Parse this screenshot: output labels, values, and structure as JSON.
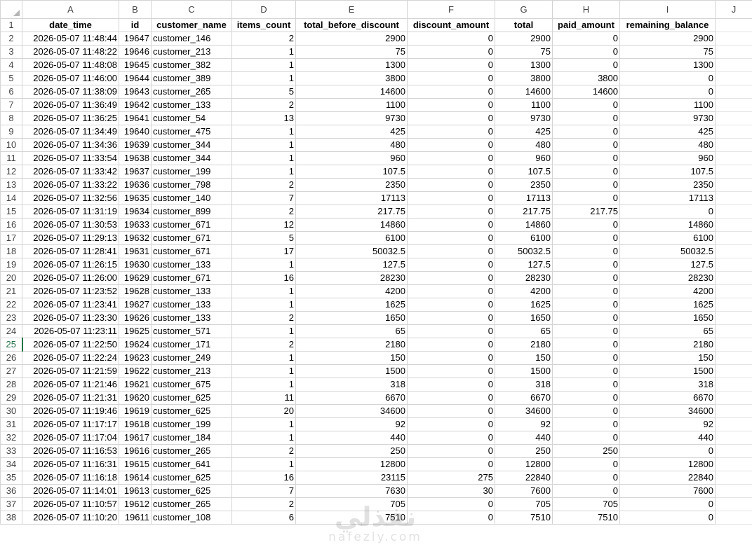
{
  "sheet": {
    "column_letters": [
      "A",
      "B",
      "C",
      "D",
      "E",
      "F",
      "G",
      "H",
      "I",
      "J"
    ],
    "active_row": 25,
    "headers": [
      "date_time",
      "id",
      "customer_name",
      "items_count",
      "total_before_discount",
      "discount_amount",
      "total",
      "paid_amount",
      "remaining_balance"
    ],
    "rows": [
      [
        "2026-05-07 11:48:44",
        "19647",
        "customer_146",
        "2",
        "2900",
        "0",
        "2900",
        "0",
        "2900"
      ],
      [
        "2026-05-07 11:48:22",
        "19646",
        "customer_213",
        "1",
        "75",
        "0",
        "75",
        "0",
        "75"
      ],
      [
        "2026-05-07 11:48:08",
        "19645",
        "customer_382",
        "1",
        "1300",
        "0",
        "1300",
        "0",
        "1300"
      ],
      [
        "2026-05-07 11:46:00",
        "19644",
        "customer_389",
        "1",
        "3800",
        "0",
        "3800",
        "3800",
        "0"
      ],
      [
        "2026-05-07 11:38:09",
        "19643",
        "customer_265",
        "5",
        "14600",
        "0",
        "14600",
        "14600",
        "0"
      ],
      [
        "2026-05-07 11:36:49",
        "19642",
        "customer_133",
        "2",
        "1100",
        "0",
        "1100",
        "0",
        "1100"
      ],
      [
        "2026-05-07 11:36:25",
        "19641",
        "customer_54",
        "13",
        "9730",
        "0",
        "9730",
        "0",
        "9730"
      ],
      [
        "2026-05-07 11:34:49",
        "19640",
        "customer_475",
        "1",
        "425",
        "0",
        "425",
        "0",
        "425"
      ],
      [
        "2026-05-07 11:34:36",
        "19639",
        "customer_344",
        "1",
        "480",
        "0",
        "480",
        "0",
        "480"
      ],
      [
        "2026-05-07 11:33:54",
        "19638",
        "customer_344",
        "1",
        "960",
        "0",
        "960",
        "0",
        "960"
      ],
      [
        "2026-05-07 11:33:42",
        "19637",
        "customer_199",
        "1",
        "107.5",
        "0",
        "107.5",
        "0",
        "107.5"
      ],
      [
        "2026-05-07 11:33:22",
        "19636",
        "customer_798",
        "2",
        "2350",
        "0",
        "2350",
        "0",
        "2350"
      ],
      [
        "2026-05-07 11:32:56",
        "19635",
        "customer_140",
        "7",
        "17113",
        "0",
        "17113",
        "0",
        "17113"
      ],
      [
        "2026-05-07 11:31:19",
        "19634",
        "customer_899",
        "2",
        "217.75",
        "0",
        "217.75",
        "217.75",
        "0"
      ],
      [
        "2026-05-07 11:30:53",
        "19633",
        "customer_671",
        "12",
        "14860",
        "0",
        "14860",
        "0",
        "14860"
      ],
      [
        "2026-05-07 11:29:13",
        "19632",
        "customer_671",
        "5",
        "6100",
        "0",
        "6100",
        "0",
        "6100"
      ],
      [
        "2026-05-07 11:28:41",
        "19631",
        "customer_671",
        "17",
        "50032.5",
        "0",
        "50032.5",
        "0",
        "50032.5"
      ],
      [
        "2026-05-07 11:26:15",
        "19630",
        "customer_133",
        "1",
        "127.5",
        "0",
        "127.5",
        "0",
        "127.5"
      ],
      [
        "2026-05-07 11:26:00",
        "19629",
        "customer_671",
        "16",
        "28230",
        "0",
        "28230",
        "0",
        "28230"
      ],
      [
        "2026-05-07 11:23:52",
        "19628",
        "customer_133",
        "1",
        "4200",
        "0",
        "4200",
        "0",
        "4200"
      ],
      [
        "2026-05-07 11:23:41",
        "19627",
        "customer_133",
        "1",
        "1625",
        "0",
        "1625",
        "0",
        "1625"
      ],
      [
        "2026-05-07 11:23:30",
        "19626",
        "customer_133",
        "2",
        "1650",
        "0",
        "1650",
        "0",
        "1650"
      ],
      [
        "2026-05-07 11:23:11",
        "19625",
        "customer_571",
        "1",
        "65",
        "0",
        "65",
        "0",
        "65"
      ],
      [
        "2026-05-07 11:22:50",
        "19624",
        "customer_171",
        "2",
        "2180",
        "0",
        "2180",
        "0",
        "2180"
      ],
      [
        "2026-05-07 11:22:24",
        "19623",
        "customer_249",
        "1",
        "150",
        "0",
        "150",
        "0",
        "150"
      ],
      [
        "2026-05-07 11:21:59",
        "19622",
        "customer_213",
        "1",
        "1500",
        "0",
        "1500",
        "0",
        "1500"
      ],
      [
        "2026-05-07 11:21:46",
        "19621",
        "customer_675",
        "1",
        "318",
        "0",
        "318",
        "0",
        "318"
      ],
      [
        "2026-05-07 11:21:31",
        "19620",
        "customer_625",
        "11",
        "6670",
        "0",
        "6670",
        "0",
        "6670"
      ],
      [
        "2026-05-07 11:19:46",
        "19619",
        "customer_625",
        "20",
        "34600",
        "0",
        "34600",
        "0",
        "34600"
      ],
      [
        "2026-05-07 11:17:17",
        "19618",
        "customer_199",
        "1",
        "92",
        "0",
        "92",
        "0",
        "92"
      ],
      [
        "2026-05-07 11:17:04",
        "19617",
        "customer_184",
        "1",
        "440",
        "0",
        "440",
        "0",
        "440"
      ],
      [
        "2026-05-07 11:16:53",
        "19616",
        "customer_265",
        "2",
        "250",
        "0",
        "250",
        "250",
        "0"
      ],
      [
        "2026-05-07 11:16:31",
        "19615",
        "customer_641",
        "1",
        "12800",
        "0",
        "12800",
        "0",
        "12800"
      ],
      [
        "2026-05-07 11:16:18",
        "19614",
        "customer_625",
        "16",
        "23115",
        "275",
        "22840",
        "0",
        "22840"
      ],
      [
        "2026-05-07 11:14:01",
        "19613",
        "customer_625",
        "7",
        "7630",
        "30",
        "7600",
        "0",
        "7600"
      ],
      [
        "2026-05-07 11:10:57",
        "19612",
        "customer_265",
        "2",
        "705",
        "0",
        "705",
        "705",
        "0"
      ],
      [
        "2026-05-07 11:10:20",
        "19611",
        "customer_108",
        "6",
        "7510",
        "0",
        "7510",
        "7510",
        "0"
      ]
    ]
  },
  "watermark": {
    "text": "نفذلي",
    "subtext": "nafezly.com"
  }
}
